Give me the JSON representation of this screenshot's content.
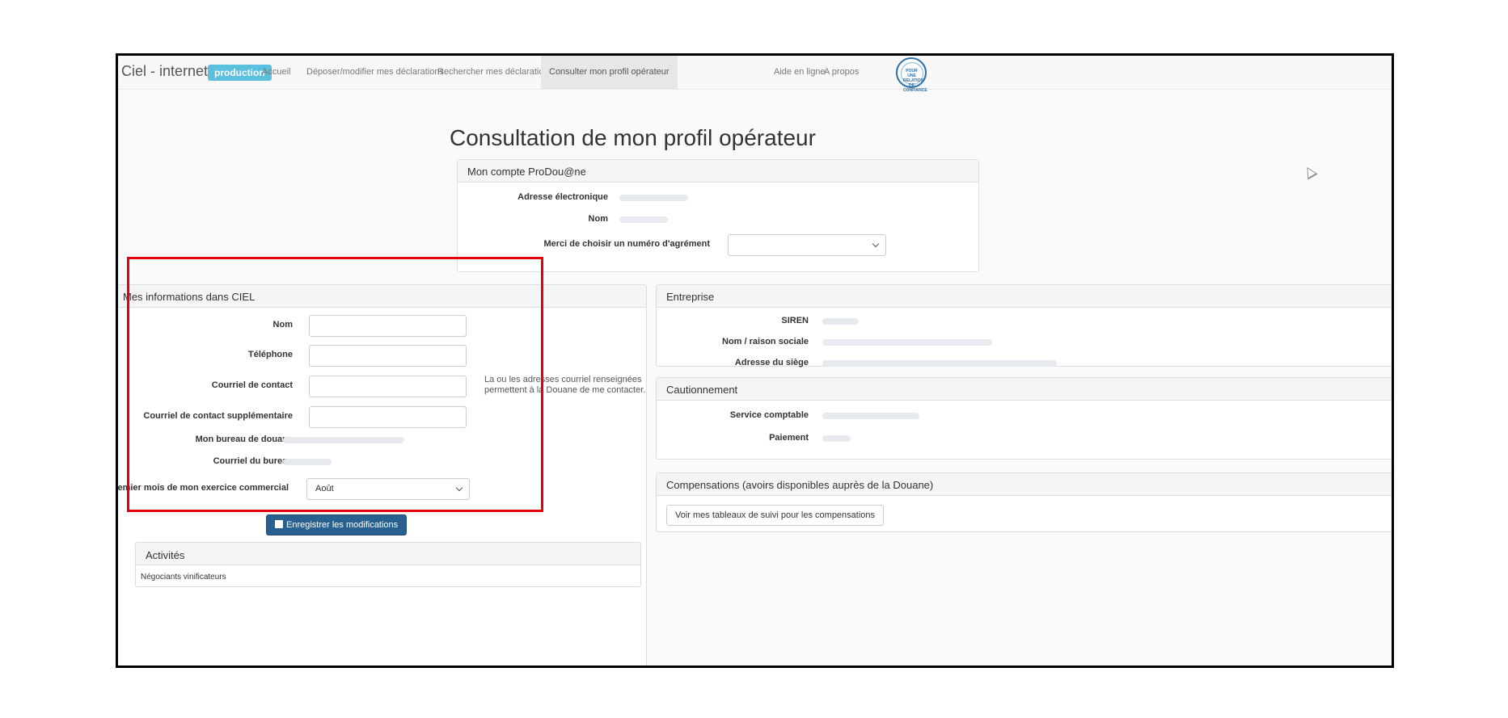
{
  "nav": {
    "brand": "Ciel - internet",
    "env_badge": "production",
    "items": [
      "Accueil",
      "Déposer/modifier mes déclarations",
      "Rechercher mes déclarations",
      "Consulter mon profil opérateur",
      "Aide en ligne",
      "A propos"
    ],
    "active_index": 3,
    "seal_text": "POUR UNE RELATION DE CONFIANCE",
    "power_icon": "power-icon"
  },
  "page_title": "Consultation de mon profil opérateur",
  "prodouane": {
    "header": "Mon compte ProDou@ne",
    "email_label": "Adresse électronique",
    "name_label": "Nom",
    "agrement_label": "Merci de choisir un numéro d'agrément",
    "agrement_value": ""
  },
  "ciel": {
    "header": "Mes informations dans CIEL",
    "nom_label": "Nom",
    "tel_label": "Téléphone",
    "courriel_label": "Courriel de contact",
    "courriel_sup_label": "Courriel de contact supplémentaire",
    "bureau_label": "Mon bureau de douane",
    "courriel_bureau_label": "Courriel du bureau",
    "mois_label": "Premier mois de mon exercice commercial",
    "mois_value": "Août",
    "help_line1": "La ou les adresses courriel renseignées",
    "help_line2": "permettent à la Douane de me contacter.",
    "save_button": "Enregistrer les modifications"
  },
  "activites": {
    "header": "Activités",
    "item": "Négociants vinificateurs"
  },
  "entreprise": {
    "header": "Entreprise",
    "siren_label": "SIREN",
    "raison_label": "Nom / raison sociale",
    "siege_label": "Adresse du siège"
  },
  "cautionnement": {
    "header": "Cautionnement",
    "service_label": "Service comptable",
    "paiement_label": "Paiement"
  },
  "compensations": {
    "header": "Compensations (avoirs disponibles auprès de la Douane)",
    "button": "Voir mes tableaux de suivi pour les compensations"
  },
  "colors": {
    "badge": "#5bc0de",
    "primary": "#286090",
    "highlight": "#e0000e"
  }
}
